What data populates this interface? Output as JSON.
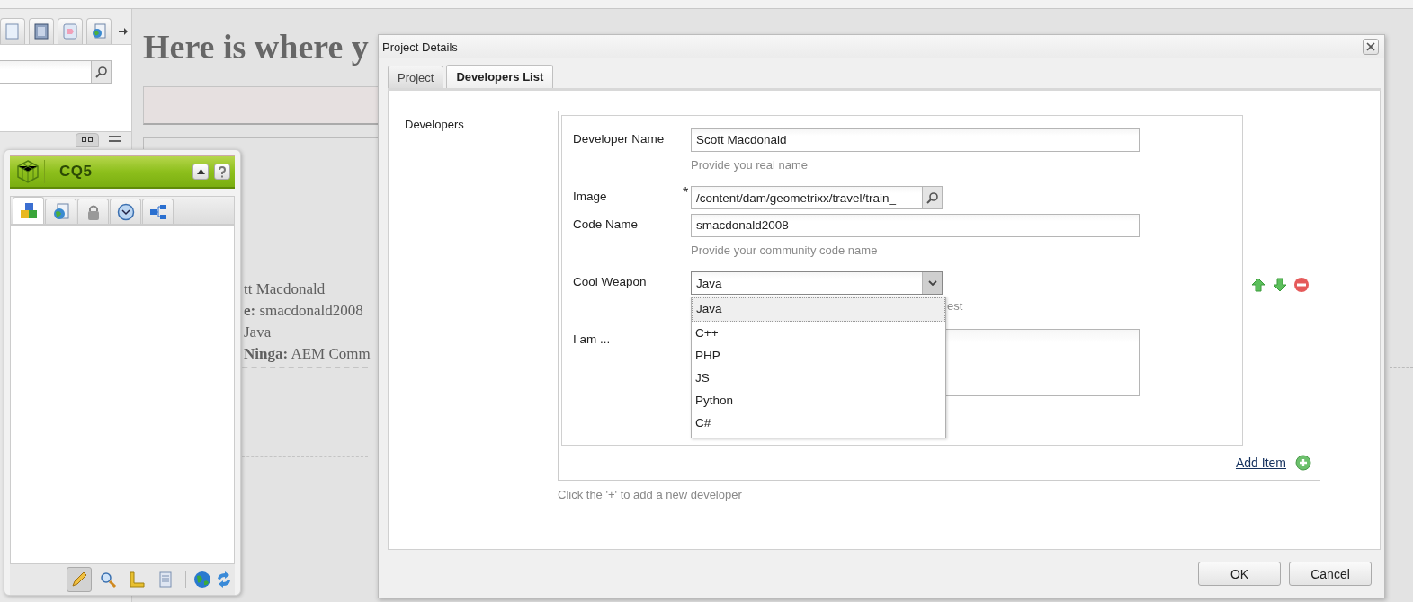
{
  "page": {
    "heading": "Here is where y",
    "lines": [
      "tt Macdonald",
      "**e:** smacdonald2008",
      "Java",
      "**Ninga:** AEM Comm"
    ]
  },
  "cq5_panel": {
    "title": "CQ5",
    "tabs": [
      {
        "selected": true
      },
      {
        "selected": false
      },
      {
        "selected": false
      },
      {
        "selected": false
      },
      {
        "selected": false
      }
    ],
    "tools": [
      {
        "selected": true
      },
      {
        "selected": false
      },
      {
        "selected": false
      },
      {
        "selected": false
      }
    ]
  },
  "dialog": {
    "title": "Project Details",
    "tabs": [
      {
        "label": "Project",
        "selected": false
      },
      {
        "label": "Developers List",
        "selected": true
      }
    ],
    "field_label": "Developers",
    "fields": [
      {
        "kind": "text",
        "label": "Developer Name",
        "value": "Scott Macdonald",
        "hint": "Provide you real name"
      },
      {
        "kind": "browse",
        "label": "Image",
        "required_mark": "*",
        "value": "/content/dam/geometrixx/travel/train_"
      },
      {
        "kind": "text",
        "label": "Code Name",
        "value": "smacdonald2008",
        "hint": "Provide your community code name"
      },
      {
        "kind": "select",
        "label": "Cool Weapon",
        "value": "Java",
        "hint": "est",
        "expanded": true,
        "options": [
          {
            "label": "Java",
            "selected": true
          },
          {
            "label": "C++",
            "selected": false
          },
          {
            "label": "PHP",
            "selected": false
          },
          {
            "label": "JS",
            "selected": false
          },
          {
            "label": "Python",
            "selected": false
          },
          {
            "label": "C#",
            "selected": false
          }
        ]
      },
      {
        "kind": "textarea",
        "label": "I am ..."
      }
    ],
    "add_item": "Add Item",
    "help": "Click the '+' to add a new developer",
    "buttons": [
      "OK",
      "Cancel"
    ]
  }
}
